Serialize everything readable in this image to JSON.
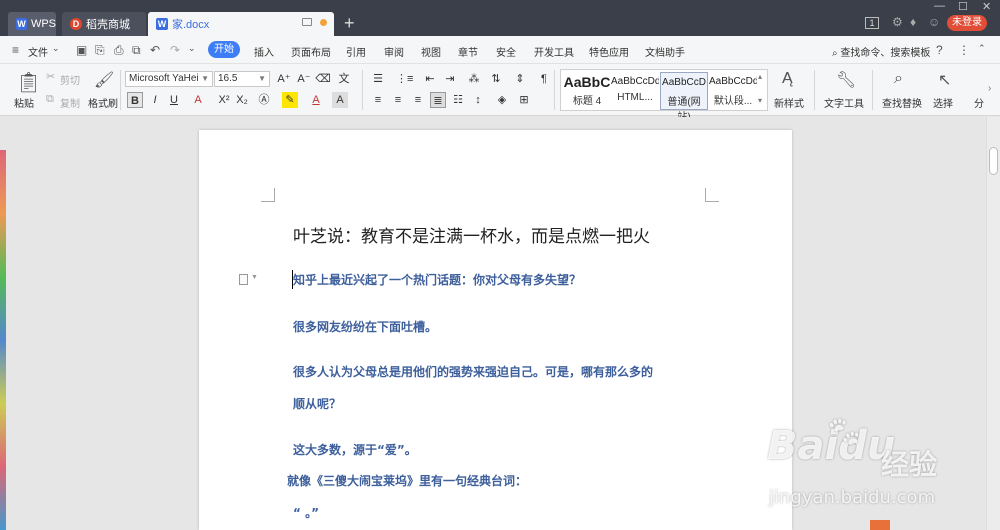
{
  "titlebar": {
    "tabs": [
      {
        "label": "WPS",
        "icon": "W"
      },
      {
        "label": "稻壳商城",
        "icon": "D"
      },
      {
        "label": "家.docx",
        "icon": "W"
      }
    ],
    "new_tab": "+",
    "window_count": "1",
    "login_label": "未登录",
    "minimize": "—",
    "maximize": "☐",
    "close": "✕"
  },
  "menubar": {
    "file_menu": "文件",
    "tabs": [
      "开始",
      "插入",
      "页面布局",
      "引用",
      "审阅",
      "视图",
      "章节",
      "安全",
      "开发工具",
      "特色应用",
      "文档助手"
    ],
    "search_label": "查找命令、搜索模板",
    "help": "?",
    "more": "⋮"
  },
  "ribbon": {
    "paste": "粘贴",
    "cut": "剪切",
    "copy": "复制",
    "format_painter": "格式刷",
    "font_name": "Microsoft YaHei",
    "font_size": "16.5",
    "styles": [
      {
        "preview": "AaBbC",
        "caption": "标题 4"
      },
      {
        "preview": "AaBbCcDd",
        "caption": "HTML..."
      },
      {
        "preview": "AaBbCcD",
        "caption": "普通(网站)"
      },
      {
        "preview": "AaBbCcDd",
        "caption": "默认段..."
      }
    ],
    "new_style": "新样式",
    "text_tools": "文字工具",
    "find_replace": "查找替换",
    "select": "选择",
    "split": "分"
  },
  "document": {
    "title": "叶芝说：教育不是注满一杯水，而是点燃一把火",
    "paragraphs": [
      "知乎上最近兴起了一个热门话题：你对父母有多失望？",
      "很多网友纷纷在下面吐槽。",
      "很多人认为父母总是用他们的强势来强迫自己。可是，哪有那么多的",
      "顺从呢？",
      "这大多数，源于“爱”。",
      "就像《三傻大闹宝莱坞》里有一句经典台词：",
      "“          。”"
    ]
  },
  "watermark": {
    "logo": "Bai",
    "logo2": "du",
    "text": "经验",
    "url": "jingyan.baidu.com"
  },
  "colors": {
    "titlebar_bg": "#3a3f4a",
    "accent": "#3d7df5",
    "paragraph_text": "#3d5f9c",
    "login_bg": "#e14d36"
  }
}
